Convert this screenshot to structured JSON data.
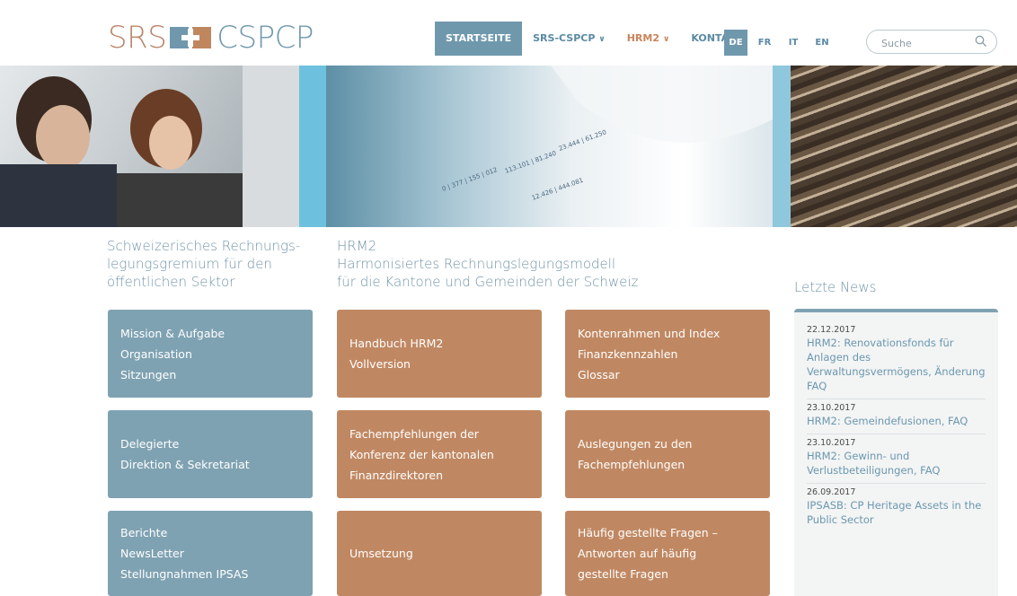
{
  "logo": {
    "left": "SRS",
    "right": "CSPCP"
  },
  "nav": [
    {
      "label": "STARTSEITE",
      "chevron": ""
    },
    {
      "label": "SRS-CSPCP",
      "chevron": "∨"
    },
    {
      "label": "HRM2",
      "chevron": "∨"
    },
    {
      "label": "KONTAKT",
      "chevron": ""
    }
  ],
  "languages": [
    "DE",
    "FR",
    "IT",
    "EN"
  ],
  "search": {
    "placeholder": "Suche",
    "icon": "search-icon"
  },
  "left_column": {
    "heading": [
      "Schweizerisches Rechnungs-",
      "legungsgremium für den",
      "öffentlichen Sektor"
    ],
    "tiles": [
      [
        "Mission & Aufgabe",
        "Organisation",
        "Sitzungen"
      ],
      [
        "Delegierte",
        "Direktion & Sekretariat"
      ],
      [
        "Berichte",
        "NewsLetter",
        "Stellungnahmen IPSAS"
      ]
    ]
  },
  "hrm2_column": {
    "heading": [
      "HRM2",
      "Harmonisiertes Rechnungslegungsmodell",
      "für die Kantone und Gemeinden der Schweiz"
    ],
    "tiles_left": [
      [
        "Handbuch HRM2",
        "Vollversion"
      ],
      [
        "Fachempfehlungen der",
        "Konferenz der kantonalen",
        "Finanzdirektoren"
      ],
      [
        "Umsetzung"
      ]
    ],
    "tiles_right": [
      [
        "Kontenrahmen und Index",
        "Finanzkennzahlen",
        "Glossar"
      ],
      [
        "Auslegungen zu den",
        "Fachempfehlungen"
      ],
      [
        "Häufig gestellte Fragen –",
        "Antworten auf häufig",
        "gestellte Fragen"
      ]
    ]
  },
  "news": {
    "title": "Letzte News",
    "items": [
      {
        "date": "22.12.2017",
        "text": "HRM2: Renovationsfonds für Anlagen des Verwaltungsvermögens, Änderung FAQ"
      },
      {
        "date": "23.10.2017",
        "text": "HRM2: Gemeindefusionen, FAQ"
      },
      {
        "date": "23.10.2017",
        "text": "HRM2: Gewinn- und Verlustbeteiligungen, FAQ"
      },
      {
        "date": "26.09.2017",
        "text": "IPSASB: CP Heritage Assets in the Public Sector"
      }
    ]
  },
  "colors": {
    "blue": "#7fa2b2",
    "orange": "#c08862",
    "nav_active": "#6f98ad",
    "hrm2_nav": "#c9845a"
  }
}
